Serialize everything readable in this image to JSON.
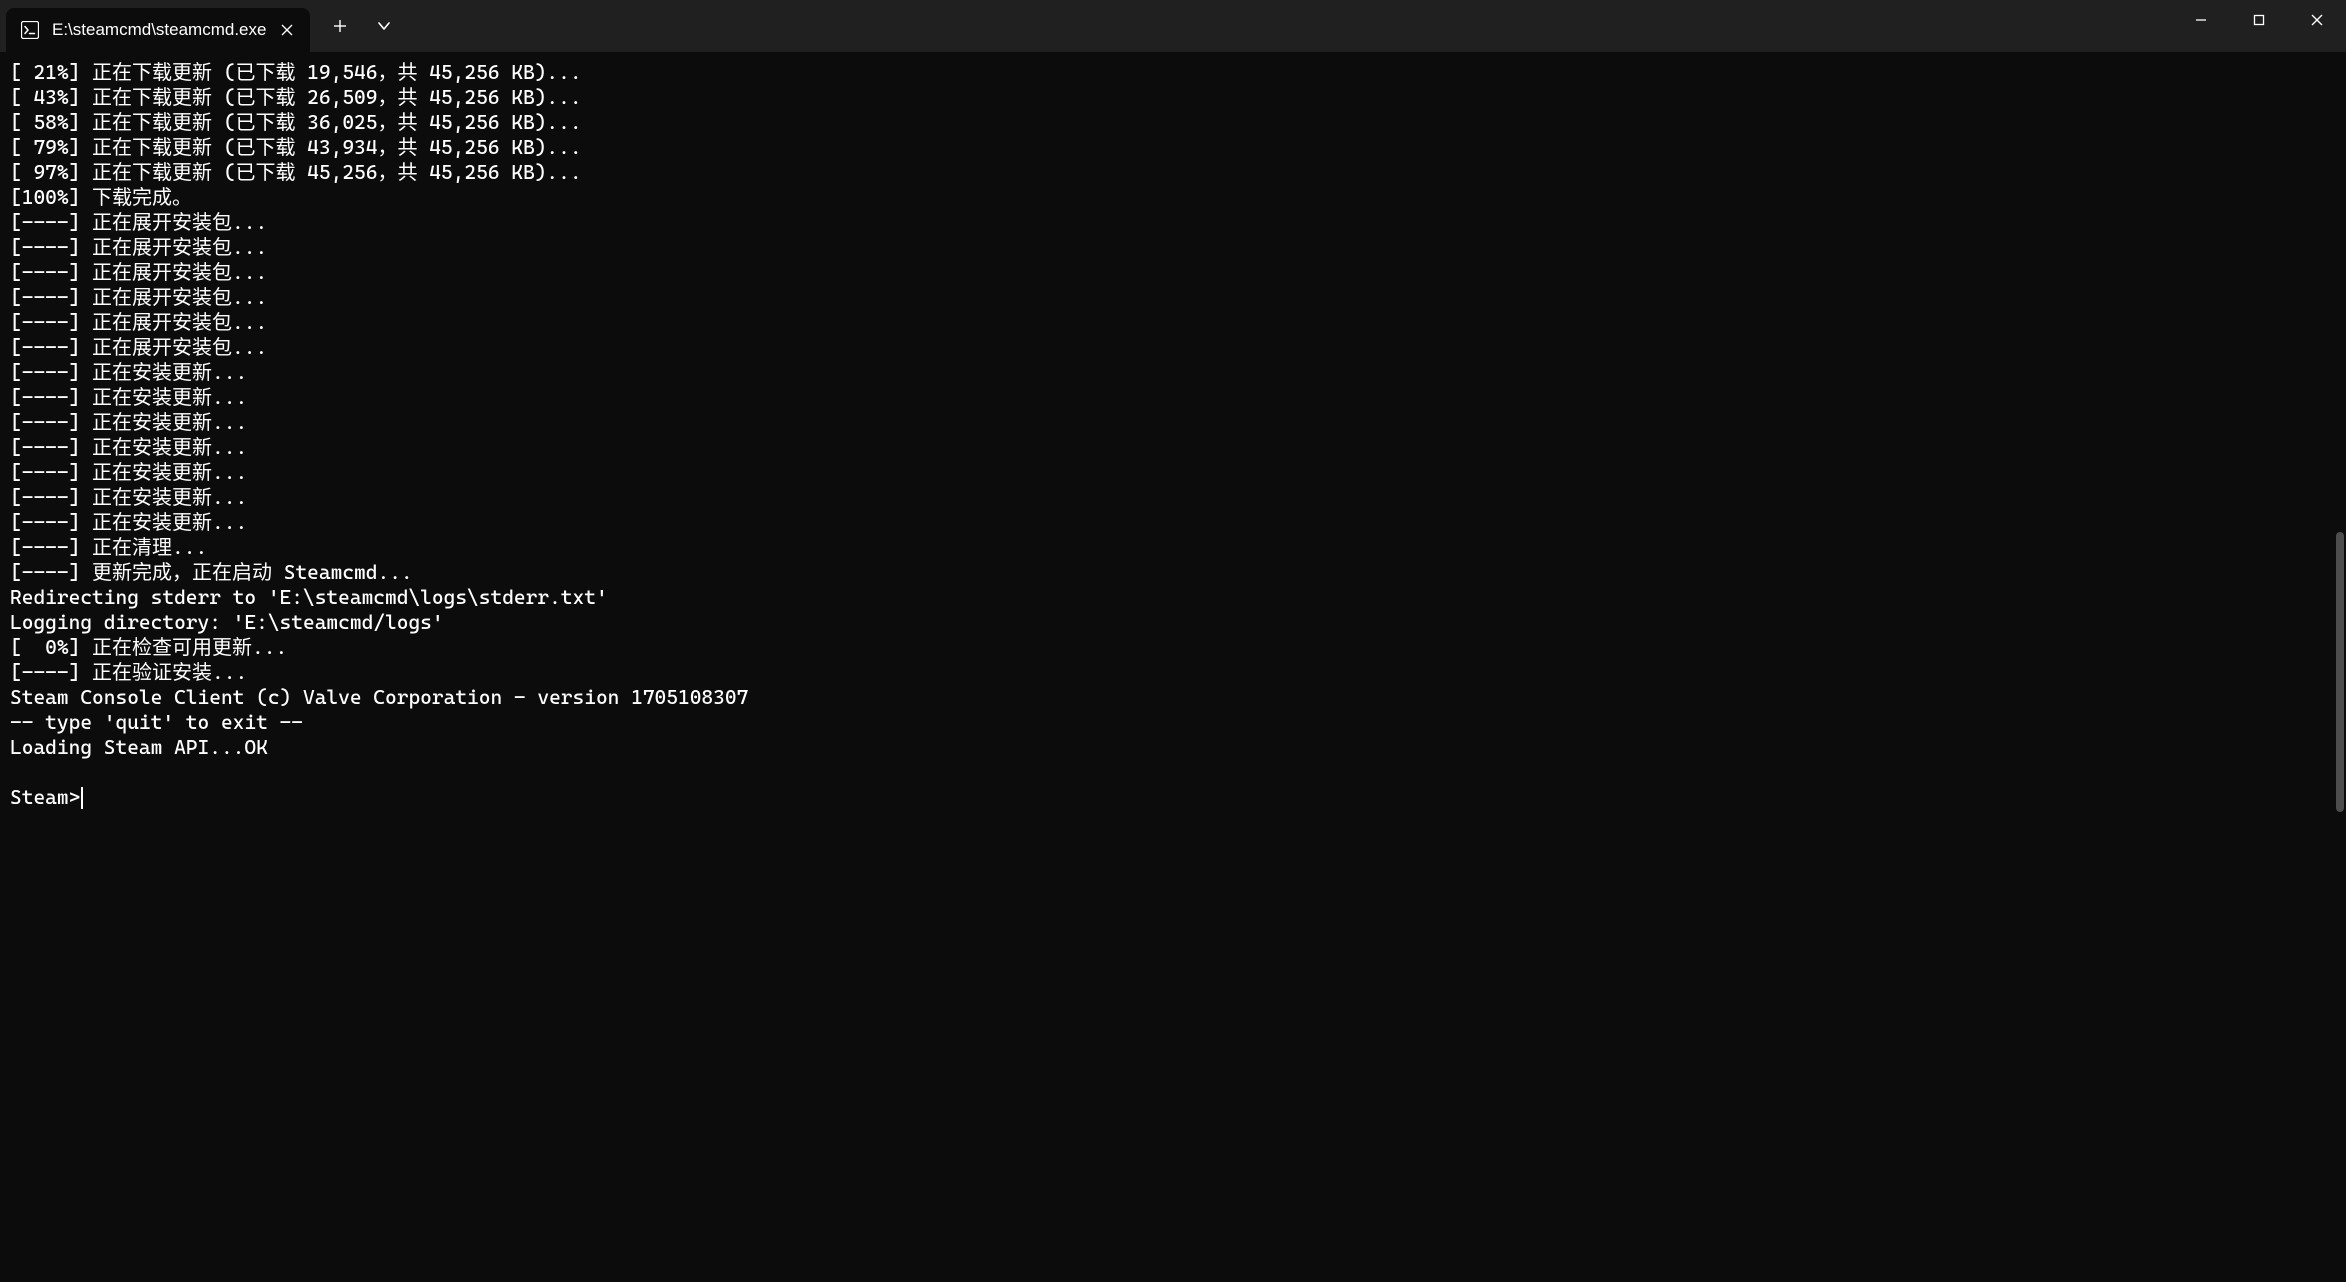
{
  "window": {
    "tab_title": "E:\\steamcmd\\steamcmd.exe"
  },
  "terminal": {
    "lines": [
      "[ 21%] 正在下载更新 (已下载 19,546，共 45,256 KB)...",
      "[ 43%] 正在下载更新 (已下载 26,509，共 45,256 KB)...",
      "[ 58%] 正在下载更新 (已下载 36,025，共 45,256 KB)...",
      "[ 79%] 正在下载更新 (已下载 43,934，共 45,256 KB)...",
      "[ 97%] 正在下载更新 (已下载 45,256，共 45,256 KB)...",
      "[100%] 下载完成。",
      "[----] 正在展开安装包...",
      "[----] 正在展开安装包...",
      "[----] 正在展开安装包...",
      "[----] 正在展开安装包...",
      "[----] 正在展开安装包...",
      "[----] 正在展开安装包...",
      "[----] 正在安装更新...",
      "[----] 正在安装更新...",
      "[----] 正在安装更新...",
      "[----] 正在安装更新...",
      "[----] 正在安装更新...",
      "[----] 正在安装更新...",
      "[----] 正在安装更新...",
      "[----] 正在清理...",
      "[----] 更新完成，正在启动 Steamcmd...",
      "Redirecting stderr to 'E:\\steamcmd\\logs\\stderr.txt'",
      "Logging directory: 'E:\\steamcmd/logs'",
      "[  0%] 正在检查可用更新...",
      "[----] 正在验证安装...",
      "Steam Console Client (c) Valve Corporation - version 1705108307",
      "-- type 'quit' to exit --",
      "Loading Steam API...OK",
      ""
    ],
    "prompt": "Steam>"
  }
}
